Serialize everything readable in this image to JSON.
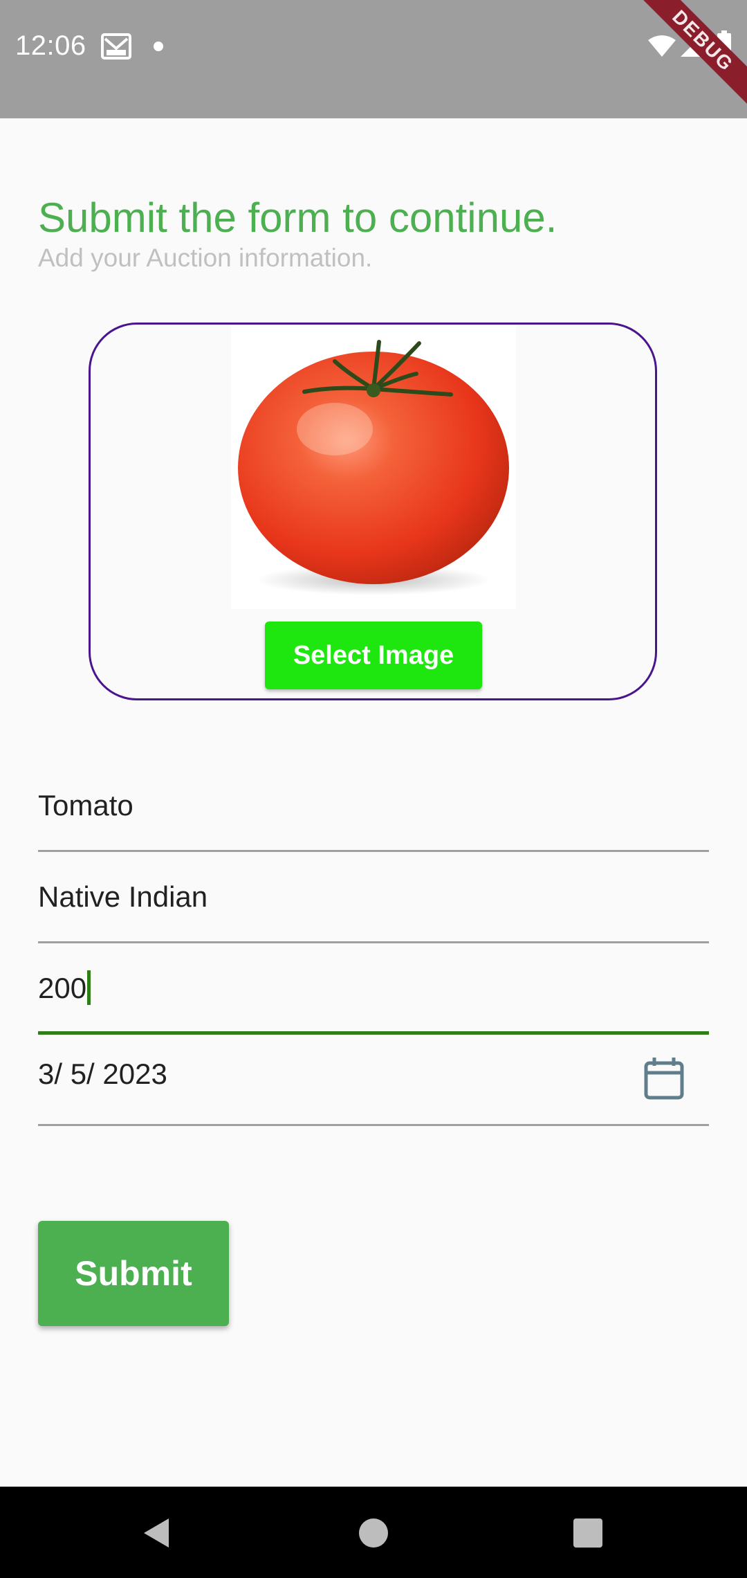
{
  "status_bar": {
    "time": "12:06",
    "icons": [
      "mail-icon",
      "notification-dot-icon",
      "wifi-icon",
      "signal-icon",
      "battery-icon"
    ],
    "debug_label": "DEBUG"
  },
  "header": {
    "title": "Submit the form to continue.",
    "subtitle": "Add your Auction information."
  },
  "image_picker": {
    "preview_icon": "tomato-image",
    "select_label": "Select Image"
  },
  "form": {
    "fields": [
      {
        "value": "Tomato"
      },
      {
        "value": "Native Indian"
      },
      {
        "value": "200",
        "focused": true
      },
      {
        "value": "3/ 5/ 2023",
        "icon": "calendar-icon"
      }
    ]
  },
  "actions": {
    "submit_label": "Submit"
  },
  "nav_bar": {
    "icons": [
      "back-icon",
      "home-icon",
      "recents-icon"
    ]
  },
  "colors": {
    "accent": "#4caf50",
    "select_button": "#1ee60f",
    "card_border": "#4a148c",
    "focused_underline": "#2e7d16",
    "status_bar": "#9e9e9e"
  }
}
